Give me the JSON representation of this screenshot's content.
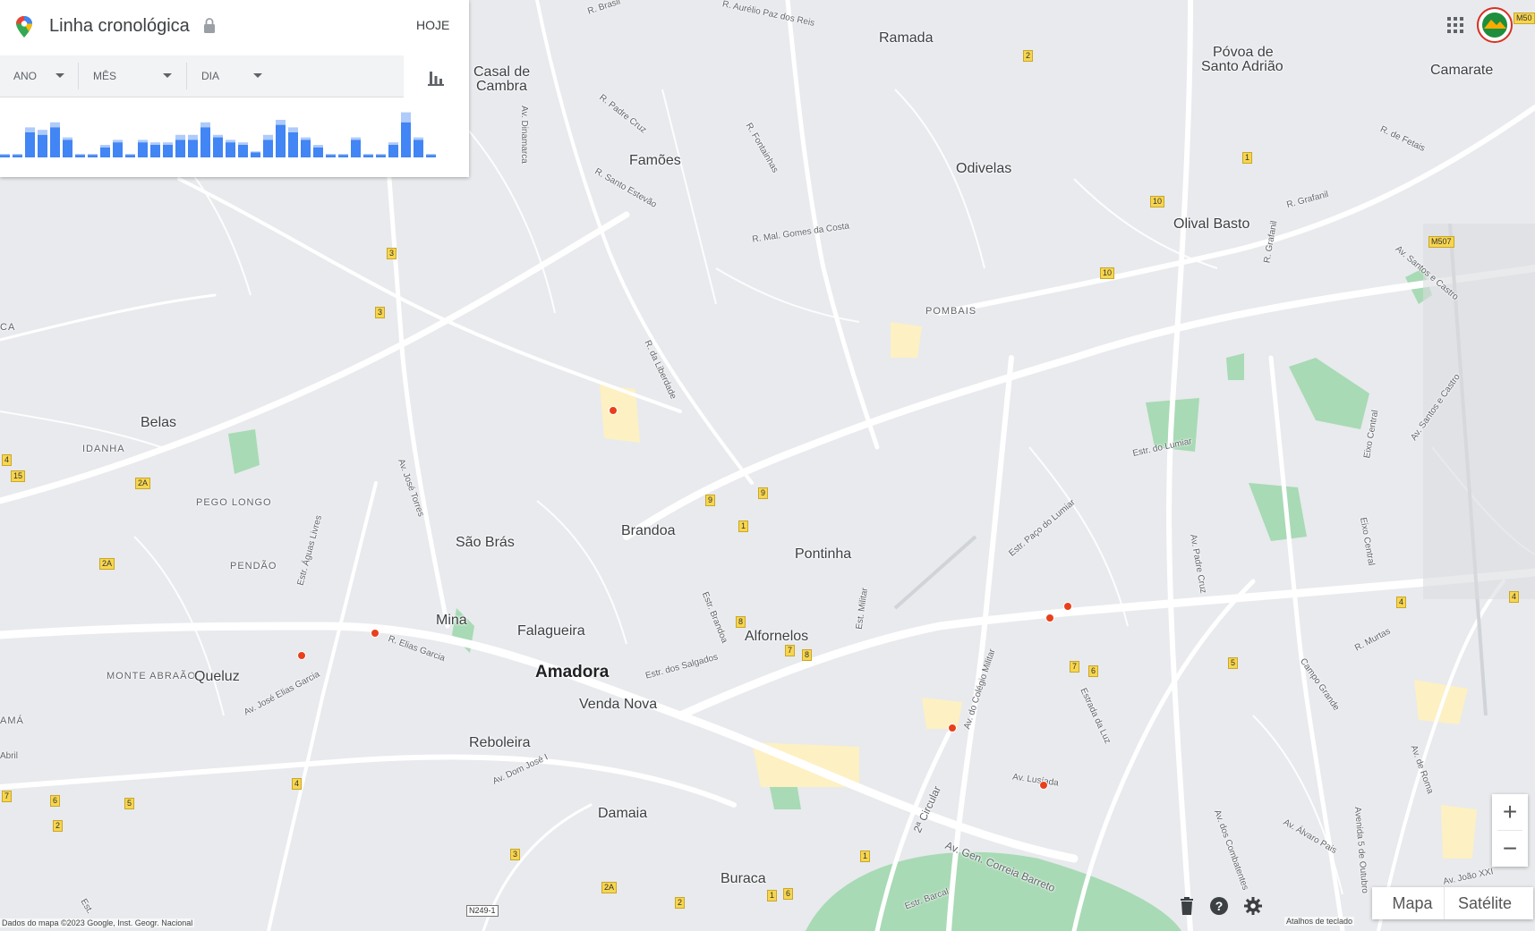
{
  "panel": {
    "title": "Linha cronológica",
    "today_label": "HOJE",
    "selectors": {
      "year": "ANO",
      "month": "MÊS",
      "day": "DIA"
    }
  },
  "timeline_bars": [
    [
      0.05,
      0.02
    ],
    [
      0.05,
      0.02
    ],
    [
      0.5,
      0.1
    ],
    [
      0.45,
      0.1
    ],
    [
      0.6,
      0.1
    ],
    [
      0.35,
      0.05
    ],
    [
      0.05,
      0.02
    ],
    [
      0.05,
      0.02
    ],
    [
      0.2,
      0.05
    ],
    [
      0.3,
      0.05
    ],
    [
      0.05,
      0.02
    ],
    [
      0.3,
      0.05
    ],
    [
      0.25,
      0.05
    ],
    [
      0.25,
      0.05
    ],
    [
      0.35,
      0.1
    ],
    [
      0.35,
      0.1
    ],
    [
      0.6,
      0.1
    ],
    [
      0.4,
      0.05
    ],
    [
      0.3,
      0.05
    ],
    [
      0.25,
      0.05
    ],
    [
      0.1,
      0.02
    ],
    [
      0.35,
      0.1
    ],
    [
      0.65,
      0.1
    ],
    [
      0.5,
      0.1
    ],
    [
      0.35,
      0.05
    ],
    [
      0.2,
      0.05
    ],
    [
      0.05,
      0.02
    ],
    [
      0.05,
      0.02
    ],
    [
      0.35,
      0.05
    ],
    [
      0.05,
      0.02
    ],
    [
      0.05,
      0.02
    ],
    [
      0.25,
      0.05
    ],
    [
      0.7,
      0.2
    ],
    [
      0.35,
      0.05
    ],
    [
      0.05,
      0.02
    ]
  ],
  "places": {
    "ramada": "Ramada",
    "povoa": "Póvoa de",
    "santo_adriao": "Santo Adrião",
    "camarate": "Camarate",
    "casal1": "Casal de",
    "casal2": "Cambra",
    "famoes": "Famões",
    "odivelas": "Odivelas",
    "olival": "Olival Basto",
    "pombais": "POMBAIS",
    "belas": "Belas",
    "idanha": "IDANHA",
    "pego": "PEGO LONGO",
    "pendao": "PENDÃO",
    "sao_bras": "São Brás",
    "brandoa": "Brandoa",
    "pontinha": "Pontinha",
    "mina": "Mina",
    "falagueira": "Falagueira",
    "alfornelos": "Alfornelos",
    "amadora": "Amadora",
    "monte_abraao": "MONTE ABRAÃO",
    "queluz": "Queluz",
    "venda_nova": "Venda Nova",
    "reboleira": "Reboleira",
    "damaia": "Damaia",
    "buraca": "Buraca",
    "ama": "AMÁ",
    "ca": "CA"
  },
  "roads": {
    "r_brasil": "R. Brasil",
    "aurelio": "R. Aurélio Paz dos Reis",
    "padre_cruz": "R. Padre Cruz",
    "av_dinamarca": "Av. Dinamarca",
    "fontainhas": "R. Fontainhas",
    "santo_estevao": "R. Santo Estevão",
    "gomes_costa": "R. Mal. Gomes da Costa",
    "de_fetais": "R. de Fetais",
    "grafanil": "R. Grafanil",
    "r_grafanil": "R. Grafanil",
    "santos_castro": "Av. Santos e Castro",
    "santos_castro2": "Av. Santos e Castro",
    "liberdade": "R. da Liberdade",
    "estr_lumiar": "Estr. do Lumiar",
    "eixo_central": "Eixo Central",
    "eixo_central2": "Eixo Central",
    "jose_torres": "Av. José Torres",
    "paco_lumiar": "Estr. Paço do Lumiar",
    "padre_cruz_av": "Av. Padre Cruz",
    "aguas_livres": "Estr. Águas Livres",
    "elias_garcia": "R. Elias Garcia",
    "estr_brandoa": "Estr. Brandoa",
    "estr_militar": "Est. Militar",
    "murtas": "R. Murtas",
    "salgados": "Estr. dos Salgados",
    "jose_elias": "Av. José Elias Garcia",
    "colegio_militar": "Av. do Colégio Militar",
    "estrada_luz": "Estrada da Luz",
    "campo_grande": "Campo Grande",
    "av_roma": "Av. de Roma",
    "dom_jose": "Av. Dom José I",
    "lusiada": "Av. Lusíada",
    "segunda_circular": "2ª Circular",
    "combatentes": "Av. dos Combatentes",
    "alvaro_pais": "Av. Álvaro Pais",
    "outubro": "Avenida 5 de Outubro",
    "correia_barreto": "Av. Gen. Correia Barreto",
    "barcal": "Estr. Barcal",
    "joao_xxi": "Av. João XXI",
    "abril": "Abril",
    "est": "Est."
  },
  "shields": {
    "m50": "M50",
    "m507": "M507",
    "n249": "N249-1",
    "s2": "2",
    "s1": "1",
    "s10": "10",
    "s3": "3",
    "s15": "15",
    "s2a": "2A",
    "s9": "9",
    "s8": "8",
    "s7": "7",
    "s6": "6",
    "s5": "5",
    "s4": "4"
  },
  "controls": {
    "zoom_in": "+",
    "zoom_out": "−",
    "map_type_map": "Mapa",
    "map_type_satellite": "Satélite"
  },
  "footer": {
    "attribution": "Dados do mapa ©2023 Google, Inst. Geogr. Nacional",
    "shortcuts": "Atalhos de teclado"
  },
  "colors": {
    "background": "#e8eaed",
    "road": "#ffffff",
    "park": "#a8dab5",
    "pin": "#e8401c",
    "bar": "#4285f4",
    "bar_light": "#aecbfa"
  }
}
